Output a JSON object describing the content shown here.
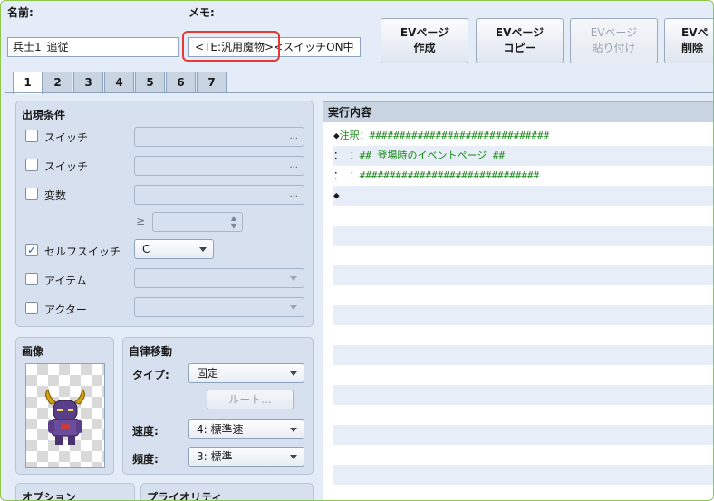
{
  "header": {
    "name_label": "名前:",
    "name_value": "兵士1_追従",
    "memo_label": "メモ:",
    "memo_value": "<TE:汎用魔物><スイッチON中"
  },
  "toolbar": {
    "create_line1": "EVページ",
    "create_line2": "作成",
    "copy_line1": "EVページ",
    "copy_line2": "コピー",
    "paste_line1": "EVページ",
    "paste_line2": "貼り付け",
    "delete_line1": "EVペ",
    "delete_line2": "削除"
  },
  "tabs": [
    "1",
    "2",
    "3",
    "4",
    "5",
    "6",
    "7"
  ],
  "conditions": {
    "title": "出現条件",
    "switch1_label": "スイッチ",
    "switch2_label": "スイッチ",
    "variable_label": "変数",
    "gte_symbol": "≥",
    "self_switch_label": "セルフスイッチ",
    "self_switch_value": "C",
    "item_label": "アイテム",
    "actor_label": "アクター",
    "ellipsis": "..."
  },
  "image": {
    "title": "画像"
  },
  "movement": {
    "title": "自律移動",
    "type_label": "タイプ:",
    "type_value": "固定",
    "route_button": "ルート...",
    "speed_label": "速度:",
    "speed_value": "4: 標準速",
    "freq_label": "頻度:",
    "freq_value": "3: 標準"
  },
  "options": {
    "title": "オプション"
  },
  "priority": {
    "title": "プライオリティ"
  },
  "contents": {
    "title": "実行内容",
    "lines": [
      {
        "prefix": "◆",
        "text": "注釈：##############################"
      },
      {
        "prefix": "：",
        "text": "      ：## 登場時のイベントページ ##"
      },
      {
        "prefix": "：",
        "text": "      ：##############################"
      },
      {
        "prefix": "◆",
        "text": ""
      }
    ]
  },
  "colors": {
    "highlight": "#e53935",
    "comment_green": "#1a8a1a",
    "panel_bg": "#d7e0ee",
    "window_bg": "#e4ecf7",
    "check_blue": "#1565c0"
  }
}
